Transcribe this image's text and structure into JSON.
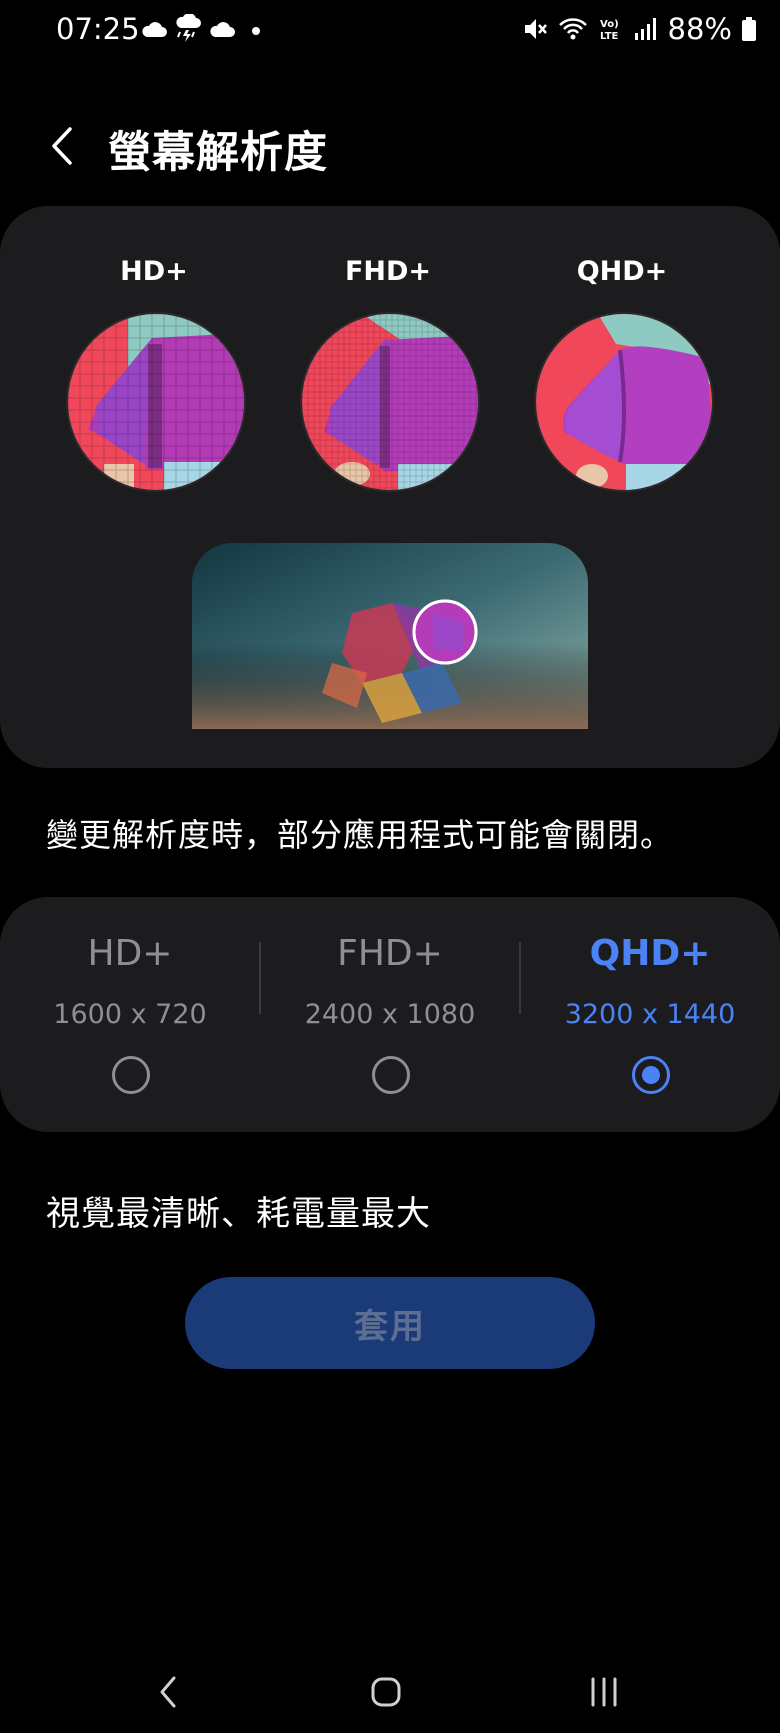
{
  "status_bar": {
    "time": "07:25",
    "battery": "88%",
    "icons": [
      "cloud-icon",
      "thunderstorm-icon",
      "cloud-icon",
      "notification-dot",
      "mute-icon",
      "wifi-icon",
      "volte-icon",
      "signal-icon",
      "battery-icon"
    ]
  },
  "header": {
    "title": "螢幕解析度",
    "back_icon": "chevron-left-icon"
  },
  "preview": {
    "labels": [
      "HD+",
      "FHD+",
      "QHD+"
    ]
  },
  "notice": "變更解析度時，部分應用程式可能會關閉。",
  "options": [
    {
      "name": "HD+",
      "resolution": "1600 x 720",
      "selected": false
    },
    {
      "name": "FHD+",
      "resolution": "2400 x 1080",
      "selected": false
    },
    {
      "name": "QHD+",
      "resolution": "3200 x 1440",
      "selected": true
    }
  ],
  "description": "視覺最清晰、耗電量最大",
  "apply_button": "套用",
  "nav_bar": {
    "icons": [
      "back-nav-icon",
      "home-nav-icon",
      "recents-nav-icon"
    ]
  },
  "colors": {
    "accent": "#4b82f6",
    "card_bg": "#1c1c1e",
    "apply_bg": "#1a3a78"
  }
}
